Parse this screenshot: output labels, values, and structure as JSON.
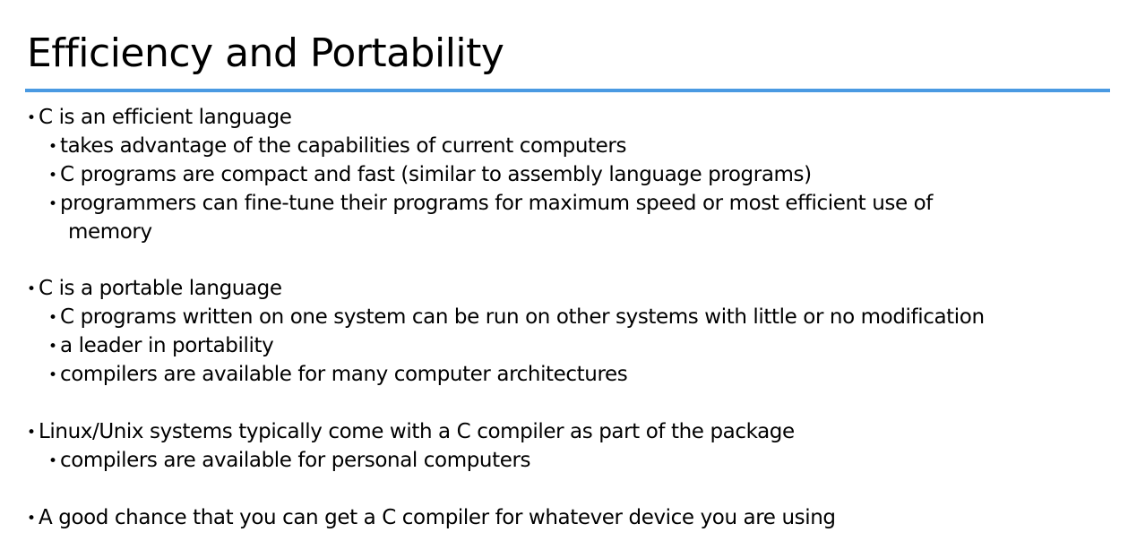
{
  "slide": {
    "title": "Efficiency and Portability",
    "accent_color": "#4a9ae2",
    "bullet_glyph": "•",
    "sections": [
      {
        "text": "C is an efficient language",
        "sub": [
          "takes advantage of the capabilities of current computers",
          "C programs are compact and fast (similar to assembly language programs)",
          "programmers can fine-tune their programs for maximum speed or most efficient use of",
          "memory"
        ]
      },
      {
        "text": "C is a portable language",
        "sub": [
          "C programs written on one system can be run on other systems with little or no modification",
          "a leader in portability",
          "compilers are available for many computer architectures"
        ]
      },
      {
        "text": "Linux/Unix systems typically come with a C compiler as part of the package",
        "sub": [
          "compilers are available for personal computers"
        ]
      },
      {
        "text": "A good chance that you can get a C compiler for whatever device you are using",
        "sub": []
      }
    ]
  }
}
